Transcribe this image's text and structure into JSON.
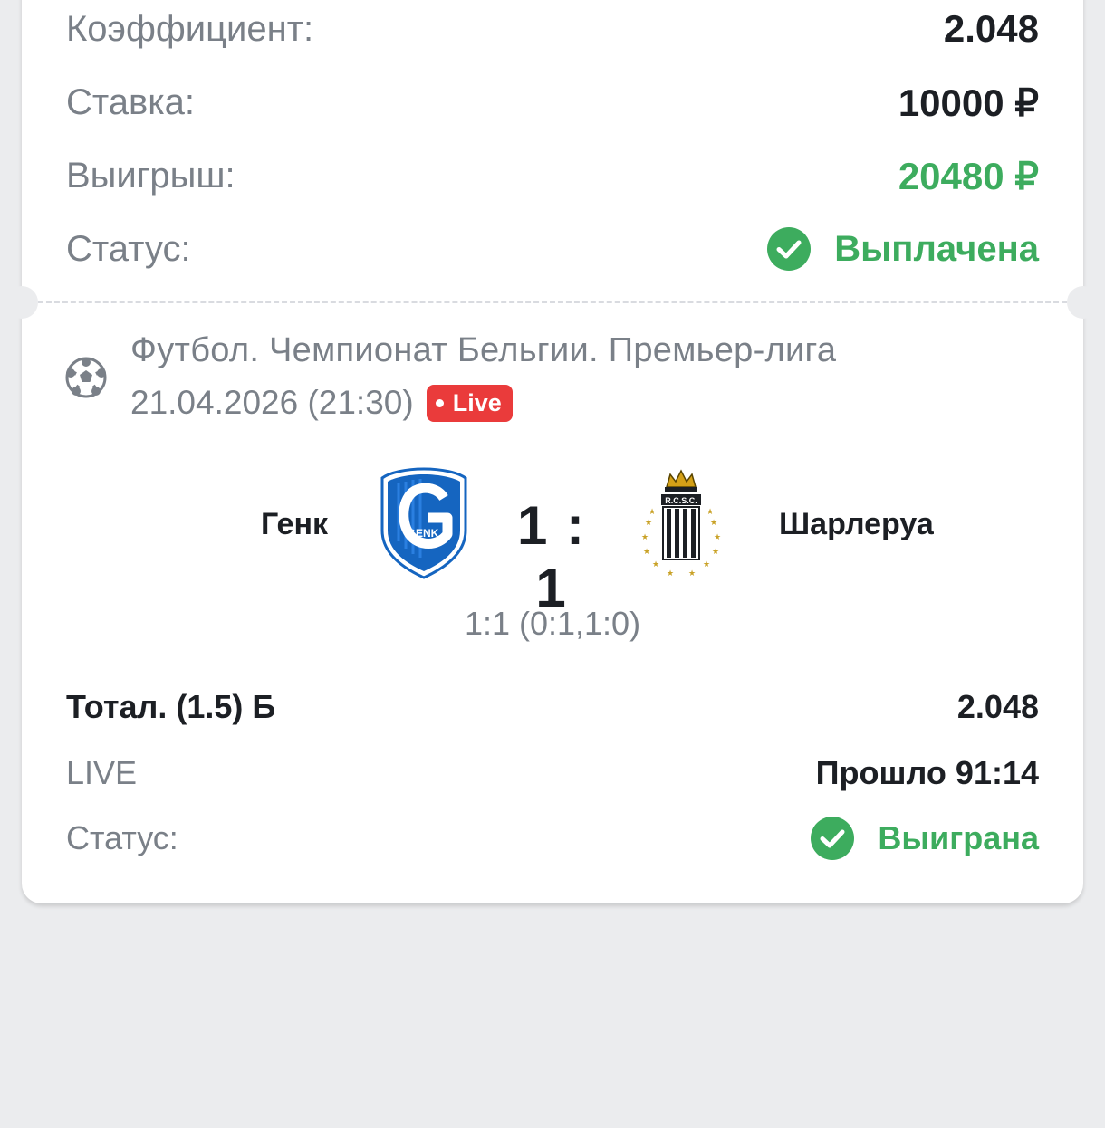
{
  "summary": {
    "odds_label": "Коэффициент:",
    "odds_value": "2.048",
    "stake_label": "Ставка:",
    "stake_value": "10000 ₽",
    "win_label": "Выигрыш:",
    "win_value": "20480 ₽",
    "status_label": "Статус:",
    "status_value": "Выплачена"
  },
  "event": {
    "league": "Футбол. Чемпионат Бельгии. Премьер-лига",
    "date": "21.04.2026 (21:30)",
    "live_badge": "Live",
    "home_team": "Генк",
    "away_team": "Шарлеруа",
    "score": "1 : 1",
    "score_detail": "1:1 (0:1,1:0)",
    "home_logo_text": "KRC GENK",
    "away_logo_text": "R.C.S.C."
  },
  "bet": {
    "market": "Тотал. (1.5) Б",
    "odds": "2.048",
    "mode": "LIVE",
    "elapsed": "Прошло 91:14",
    "status_label": "Статус:",
    "status_value": "Выиграна"
  },
  "colors": {
    "green": "#3dac5e",
    "live_red": "#ea3b3b",
    "genk_blue": "#1565c0",
    "background": "#ebecee"
  },
  "icons": [
    "check-circle-icon",
    "football-icon",
    "genk-logo",
    "charleroi-logo"
  ]
}
